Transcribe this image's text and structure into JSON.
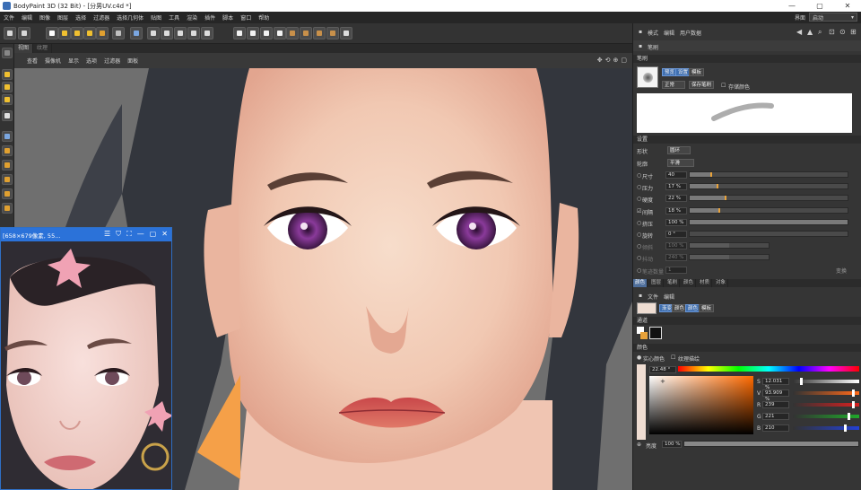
{
  "window": {
    "title": "BodyPaint 3D (32 Bit) - [分男UV.c4d *]",
    "min": "—",
    "max": "▢",
    "close": "✕"
  },
  "menu": {
    "items": [
      "文件",
      "编辑",
      "图像",
      "图层",
      "选择",
      "过滤器",
      "选择几何体",
      "贴图",
      "工具",
      "渲染",
      "插件",
      "脚本",
      "窗口",
      "帮助"
    ],
    "layout_label": "界面",
    "layout_value": "启动"
  },
  "viewport": {
    "tabs": [
      "视图",
      "纹理"
    ],
    "menu": [
      "查看",
      "摄像机",
      "显示",
      "选项",
      "过滤器",
      "面板"
    ],
    "nav_icons": [
      "✥",
      "⟲",
      "⊕",
      "▢"
    ]
  },
  "floating_window": {
    "title": "[658×679像素, 55...",
    "icons": [
      "☰",
      "⛉",
      "⛶",
      "—",
      "▢",
      "✕"
    ]
  },
  "attributes": {
    "tabs": [
      "模式",
      "编辑",
      "用户数据"
    ],
    "object_title": "笔刷",
    "section_brush": "笔刷",
    "brush_buttons": [
      "预览",
      "设置",
      "模板"
    ],
    "blend_mode": "正常",
    "save_brush": "保存笔刷",
    "store_color": "存储颜色",
    "section_settings": "设置",
    "shape_label": "形状",
    "shape_value": "圆环",
    "contour_label": "轮廓",
    "contour_value": "平滑",
    "params": [
      {
        "label": "尺寸",
        "value": "40",
        "fill": 0.13,
        "checked": false
      },
      {
        "label": "压力",
        "value": "17 %",
        "fill": 0.17,
        "checked": false
      },
      {
        "label": "硬度",
        "value": "22 %",
        "fill": 0.22,
        "checked": false
      },
      {
        "label": "间隔",
        "value": "18 %",
        "fill": 0.18,
        "checked": true
      },
      {
        "label": "挤压",
        "value": "100 %",
        "fill": 1.0,
        "checked": false
      },
      {
        "label": "旋转",
        "value": "0 °",
        "fill": 0.0,
        "checked": false
      },
      {
        "label": "倾斜",
        "value": "100 %",
        "fill": 0.5,
        "checked": false
      },
      {
        "label": "抖动",
        "value": "240 %",
        "fill": 0.5,
        "checked": false
      },
      {
        "label": "笔迹数量",
        "value": "1",
        "fill": 0.0,
        "checked": false
      }
    ],
    "vary": "变换"
  },
  "lower_tabs": [
    "颜色",
    "图层",
    "笔刷",
    "颜色",
    "材质",
    "对象"
  ],
  "color_panel": {
    "menu": [
      "文件",
      "编辑"
    ],
    "mode_buttons": [
      "渐变",
      "颜色",
      "颜色",
      "模板"
    ],
    "section_channel": "通道",
    "section_color": "颜色",
    "solid_label": "实心颜色",
    "texture_label": "纹理描绘",
    "hue_value": "22.48 °",
    "sliders": [
      {
        "label": "S",
        "value": "12.031 %",
        "fill": 0.12,
        "color": "#ffffff"
      },
      {
        "label": "V",
        "value": "93.909 %",
        "fill": 0.94,
        "color": "#ff6a1a"
      },
      {
        "label": "R",
        "value": "239",
        "fill": 0.94,
        "color": "#d62020"
      },
      {
        "label": "G",
        "value": "221",
        "fill": 0.87,
        "color": "#1fa82a"
      },
      {
        "label": "B",
        "value": "210",
        "fill": 0.82,
        "color": "#2340d6"
      }
    ],
    "brightness_label": "亮度",
    "brightness_value": "100 %"
  },
  "colors": {
    "accent_blue": "#2b72d9",
    "active_orange": "#e8a23a",
    "current_color": "#efddd2"
  }
}
